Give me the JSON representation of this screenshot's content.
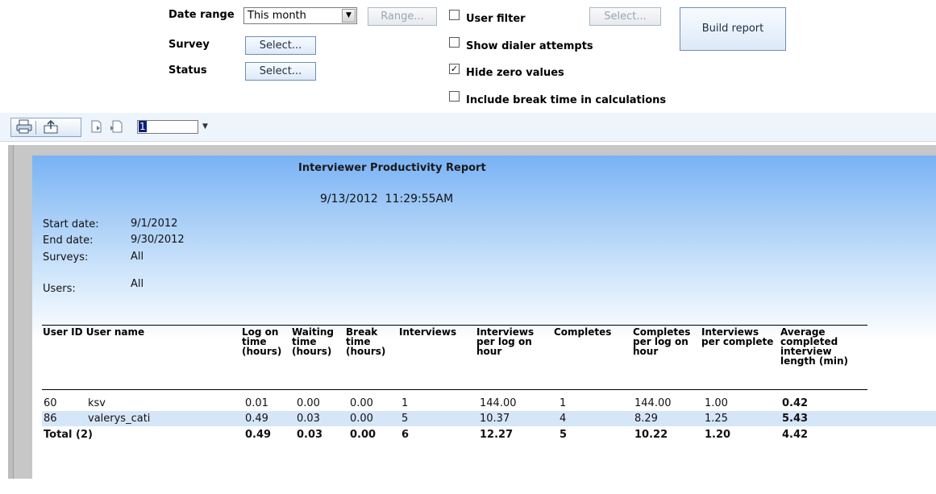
{
  "filters": {
    "date_range_label": "Date range",
    "date_range_value": "This month",
    "range_button": "Range...",
    "survey_label": "Survey",
    "survey_button": "Select...",
    "status_label": "Status",
    "status_button": "Select...",
    "user_filter_label": "User filter",
    "user_filter_checked": false,
    "user_filter_button": "Select...",
    "show_dialer_label": "Show dialer attempts",
    "show_dialer_checked": false,
    "hide_zero_label": "Hide zero values",
    "hide_zero_checked": true,
    "include_break_label": "Include break time in calculations",
    "include_break_checked": false,
    "build_button": "Build report"
  },
  "toolbar": {
    "icons": [
      "print-icon",
      "export-icon",
      "next-page-icon",
      "last-page-icon"
    ],
    "page_number": "1"
  },
  "report": {
    "title": "Interviewer Productivity Report",
    "generated": "9/13/2012  11:29:55AM",
    "info": {
      "start_date_label": "Start date:",
      "start_date": "9/1/2012",
      "end_date_label": "End date:",
      "end_date": "9/30/2012",
      "surveys_label": "Surveys:",
      "surveys": "All",
      "users_label": "Users:",
      "users": "All"
    },
    "headers": {
      "user_id_name": "User ID User name",
      "log_on": "Log on\ntime\n(hours)",
      "waiting": "Waiting\ntime\n(hours)",
      "break": "Break\ntime\n(hours)",
      "interviews": "Interviews",
      "int_per_hour": "Interviews\nper log on\nhour",
      "completes": "Completes",
      "comp_per_hour": "Completes\nper log on\nhour",
      "int_per_complete": "Interviews\nper complete",
      "avg_length": "Average\ncompleted\ninterview\nlength (min)"
    },
    "rows": [
      {
        "id": "60",
        "name": "ksv",
        "log_on": "0.01",
        "waiting": "0.00",
        "break": "0.00",
        "interviews": "1",
        "int_per_hour": "144.00",
        "completes": "1",
        "comp_per_hour": "144.00",
        "int_per_complete": "1.00",
        "avg_length": "0.42"
      },
      {
        "id": "86",
        "name": "valerys_cati",
        "log_on": "0.49",
        "waiting": "0.03",
        "break": "0.00",
        "interviews": "5",
        "int_per_hour": "10.37",
        "completes": "4",
        "comp_per_hour": "8.29",
        "int_per_complete": "1.25",
        "avg_length": "5.43"
      }
    ],
    "total": {
      "label": "Total (2)",
      "log_on": "0.49",
      "waiting": "0.03",
      "break": "0.00",
      "interviews": "6",
      "int_per_hour": "12.27",
      "completes": "5",
      "comp_per_hour": "10.22",
      "int_per_complete": "1.20",
      "avg_length": "4.42"
    }
  }
}
